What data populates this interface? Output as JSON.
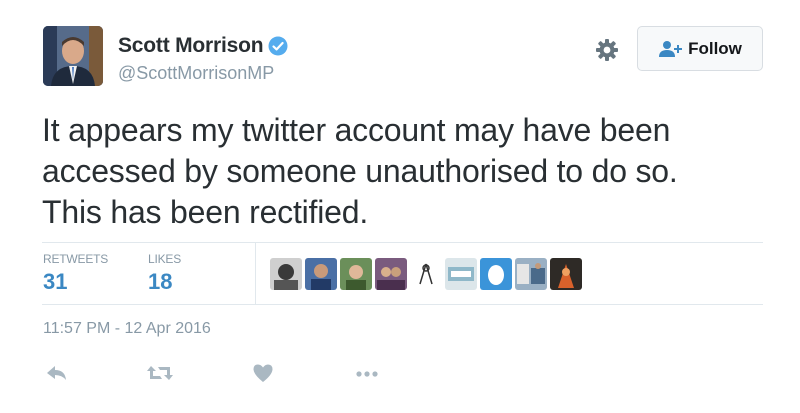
{
  "user": {
    "name": "Scott Morrison",
    "handle": "@ScottMorrisonMP",
    "verified": true
  },
  "follow_button": {
    "label": "Follow"
  },
  "tweet": {
    "lines": [
      "It appears my twitter account may have been",
      "accessed by someone unauthorised to do so.",
      "This has been rectified."
    ]
  },
  "stats": {
    "retweets_label": "RETWEETS",
    "retweets_value": "31",
    "likes_label": "LIKES",
    "likes_value": "18"
  },
  "timestamp": "11:57 PM - 12 Apr 2016",
  "icons": {
    "settings": "gear-icon",
    "follow": "add-user-icon",
    "verified": "verified-badge-icon",
    "reply": "reply-icon",
    "retweet": "retweet-icon",
    "like": "heart-icon",
    "more": "more-icon"
  },
  "colors": {
    "accent": "#3b88c3",
    "verified": "#55acee",
    "muted": "#8899a6",
    "text": "#292f33"
  }
}
